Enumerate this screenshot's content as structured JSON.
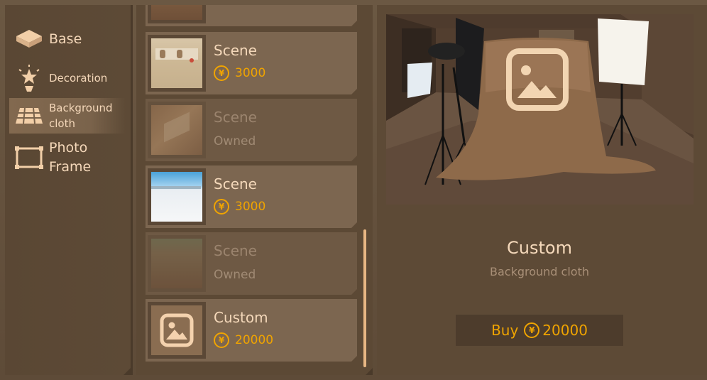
{
  "categories": [
    {
      "label": "Base",
      "icon": "base-tile-icon"
    },
    {
      "label": "Decoration",
      "icon": "decoration-star-icon"
    },
    {
      "label": "Background cloth",
      "icon": "background-cloth-icon"
    },
    {
      "label": "Photo Frame",
      "icon": "photo-frame-icon"
    }
  ],
  "selected_category": "Background cloth",
  "items": [
    {
      "name": "Scene",
      "price": "3000",
      "owned": false
    },
    {
      "name": "Scene",
      "status": "Owned",
      "owned": true
    },
    {
      "name": "Scene",
      "price": "3000",
      "owned": false
    },
    {
      "name": "Scene",
      "status": "Owned",
      "owned": true
    },
    {
      "name": "Custom",
      "price": "20000",
      "owned": false
    }
  ],
  "coin_symbol": "¥",
  "detail": {
    "title": "Custom",
    "subtitle": "Background cloth",
    "buy_label": "Buy",
    "buy_price": "20000"
  },
  "colors": {
    "accent": "#f0a400",
    "text": "#f4d8ba",
    "panel": "#5c4935"
  }
}
